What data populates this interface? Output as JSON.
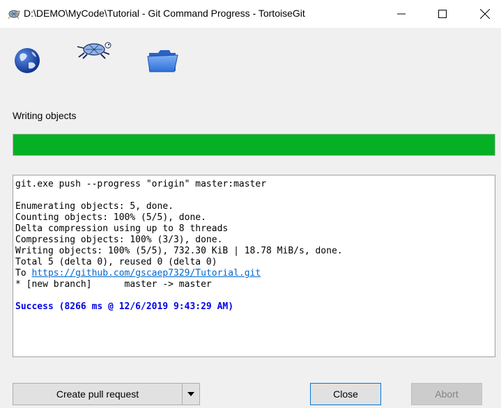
{
  "window": {
    "title": "D:\\DEMO\\MyCode\\Tutorial - Git Command Progress - TortoiseGit",
    "app_icon": "tortoise-icon",
    "controls": [
      "minimize-icon",
      "maximize-icon",
      "close-icon"
    ]
  },
  "animation_icons": [
    "globe-icon",
    "turtle-icon",
    "folder-icon"
  ],
  "status": {
    "label": "Writing objects",
    "progress_percent": 100,
    "progress_color": "#06b025"
  },
  "log": {
    "command": "git.exe push --progress \"origin\" master:master",
    "lines": [
      "Enumerating objects: 5, done.",
      "Counting objects: 100% (5/5), done.",
      "Delta compression using up to 8 threads",
      "Compressing objects: 100% (3/3), done.",
      "Writing objects: 100% (5/5), 732.30 KiB | 18.78 MiB/s, done.",
      "Total 5 (delta 0), reused 0 (delta 0)"
    ],
    "to_prefix": "To ",
    "remote_url": "https://github.com/gscaep7329/Tutorial.git",
    "branch_line": "* [new branch]      master -> master",
    "success": "Success (8266 ms @ 12/6/2019 9:43:29 AM)",
    "success_color": "#0000e6"
  },
  "buttons": {
    "create_pr": "Create pull request",
    "create_pr_dropdown": "chevron-down-icon",
    "close": "Close",
    "abort": "Abort"
  }
}
